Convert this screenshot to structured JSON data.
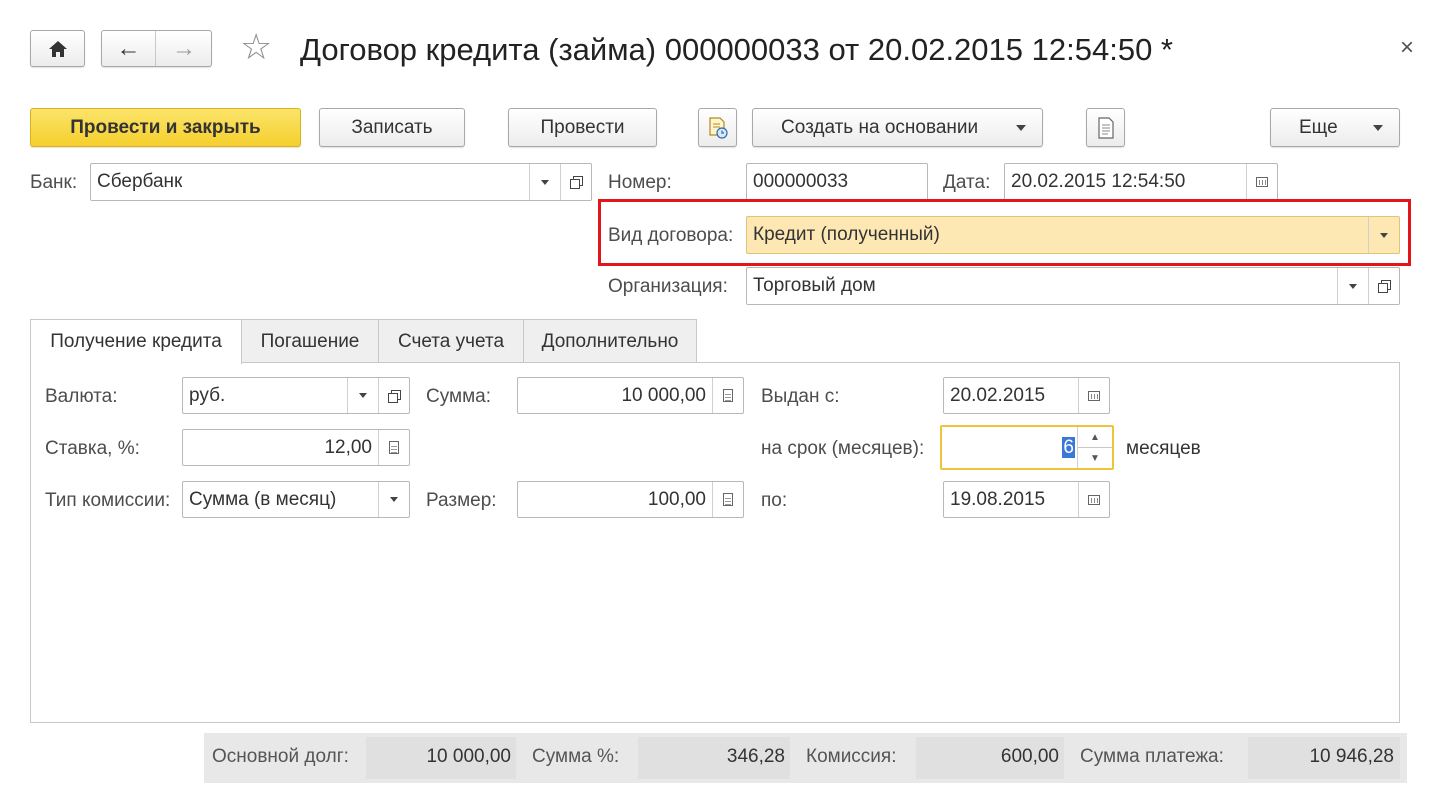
{
  "window": {
    "title": "Договор кредита (займа) 000000033 от 20.02.2015 12:54:50 *",
    "close_glyph": "×"
  },
  "nav": {
    "home": "home-icon",
    "back": "←",
    "forward": "→",
    "favorite": "☆"
  },
  "toolbar": {
    "post_close": "Провести и закрыть",
    "save": "Записать",
    "post": "Провести",
    "create_based": "Создать на основании",
    "more": "Еще"
  },
  "header": {
    "bank_label": "Банк:",
    "bank_value": "Сбербанк",
    "number_label": "Номер:",
    "number_value": "000000033",
    "date_label": "Дата:",
    "date_value": "20.02.2015 12:54:50",
    "contract_type_label": "Вид договора:",
    "contract_type_value": "Кредит (полученный)",
    "org_label": "Организация:",
    "org_value": "Торговый дом"
  },
  "tabs": [
    {
      "label": "Получение кредита",
      "active": true
    },
    {
      "label": "Погашение",
      "active": false
    },
    {
      "label": "Счета учета",
      "active": false
    },
    {
      "label": "Дополнительно",
      "active": false
    }
  ],
  "form": {
    "currency_label": "Валюта:",
    "currency_value": "руб.",
    "sum_label": "Сумма:",
    "sum_value": "10 000,00",
    "issued_label": "Выдан с:",
    "issued_value": "20.02.2015",
    "rate_label": "Ставка, %:",
    "rate_value": "12,00",
    "term_label": "на срок (месяцев):",
    "term_value": "6",
    "term_unit": "месяцев",
    "commission_type_label": "Тип комиссии:",
    "commission_type_value": "Сумма (в месяц)",
    "size_label": "Размер:",
    "size_value": "100,00",
    "until_label": "по:",
    "until_value": "19.08.2015"
  },
  "footer": {
    "principal_label": "Основной долг:",
    "principal_value": "10 000,00",
    "interest_label": "Сумма %:",
    "interest_value": "346,28",
    "commission_label": "Комиссия:",
    "commission_value": "600,00",
    "payment_label": "Сумма платежа:",
    "payment_value": "10 946,28"
  },
  "colors": {
    "primary_button": "#f5cf2d",
    "highlight_field": "#fde8b4",
    "highlight_border": "#e3151b",
    "focus_border": "#f2c33a"
  }
}
